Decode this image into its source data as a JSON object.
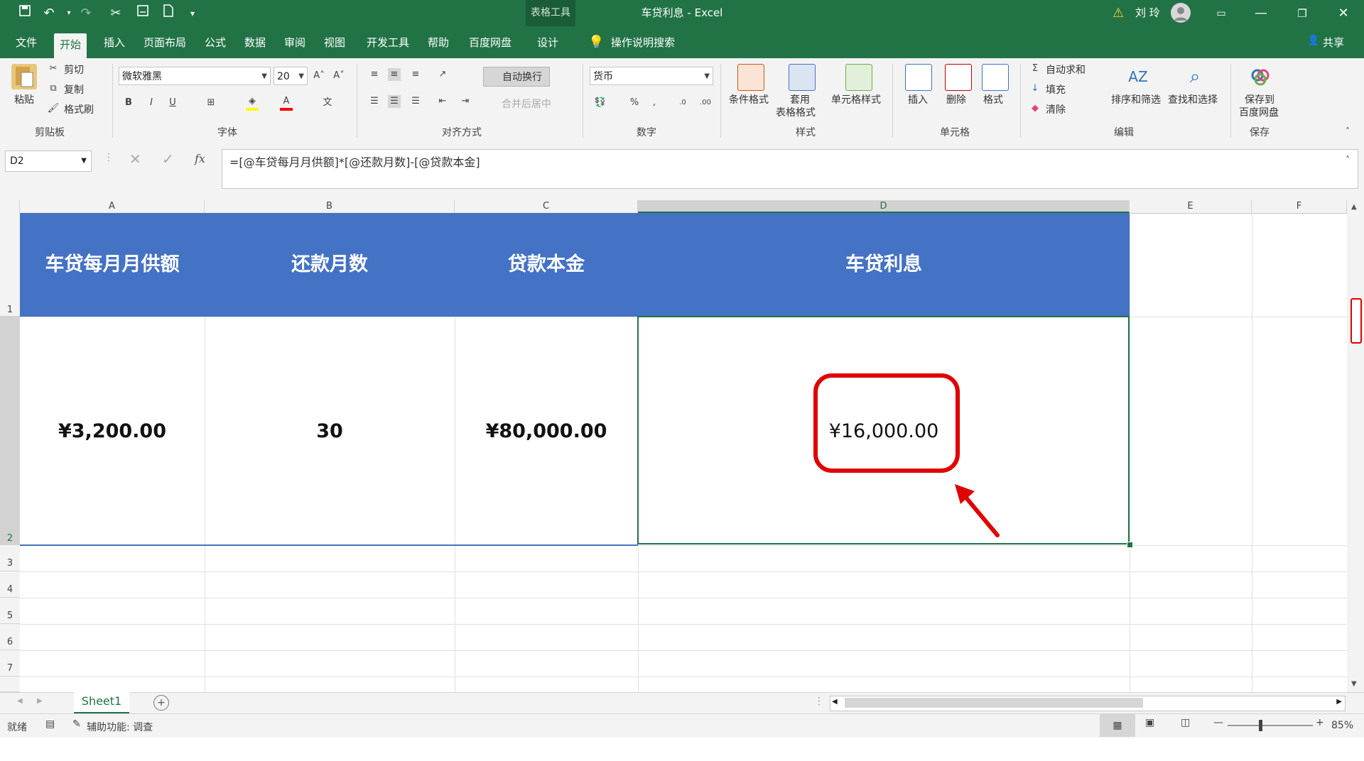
{
  "titlebar": {
    "context_tool": "表格工具",
    "title": "车贷利息  -  Excel",
    "user_name": "刘 玲"
  },
  "tabs": [
    "文件",
    "开始",
    "插入",
    "页面布局",
    "公式",
    "数据",
    "审阅",
    "视图",
    "开发工具",
    "帮助",
    "百度网盘",
    "设计"
  ],
  "search_label": "操作说明搜索",
  "share_label": "共享",
  "ribbon": {
    "clipboard": {
      "paste": "粘贴",
      "cut": "剪切",
      "copy": "复制",
      "format_painter": "格式刷",
      "label": "剪贴板"
    },
    "font": {
      "name": "微软雅黑",
      "size": "20",
      "label": "字体",
      "bold": "B",
      "italic": "I",
      "underline": "U"
    },
    "alignment": {
      "wrap": "自动换行",
      "merge": "合并后居中",
      "label": "对齐方式"
    },
    "number": {
      "format": "货币",
      "label": "数字",
      "percent": "%"
    },
    "styles": {
      "conditional": "条件格式",
      "table_line1": "套用",
      "table_line2": "表格格式",
      "cell_styles": "单元格样式",
      "label": "样式"
    },
    "cells": {
      "insert": "插入",
      "delete": "删除",
      "format": "格式",
      "label": "单元格"
    },
    "editing": {
      "autosum": "自动求和",
      "fill": "填充",
      "clear": "清除",
      "sort": "排序和筛选",
      "find": "查找和选择",
      "label": "编辑"
    },
    "save": {
      "line1": "保存到",
      "line2": "百度网盘",
      "label": "保存"
    }
  },
  "formula_bar": {
    "name_box": "D2",
    "formula": "=[@车贷每月月供额]*[@还款月数]-[@贷款本金]",
    "fx": "fx"
  },
  "columns": [
    "A",
    "B",
    "C",
    "D",
    "E",
    "F"
  ],
  "rows": [
    "1",
    "2",
    "3",
    "4",
    "5",
    "6",
    "7"
  ],
  "table": {
    "headers": [
      "车贷每月月供额",
      "还款月数",
      "贷款本金",
      "车贷利息"
    ],
    "values": [
      "¥3,200.00",
      "30",
      "¥80,000.00",
      "¥16,000.00"
    ]
  },
  "sheet_tab": "Sheet1",
  "status": {
    "ready": "就绪",
    "accessibility": "辅助功能: 调查",
    "zoom": "85%"
  },
  "colors": {
    "excel_green": "#217346",
    "header_blue": "#4472c4",
    "annotation_red": "#e00000"
  }
}
